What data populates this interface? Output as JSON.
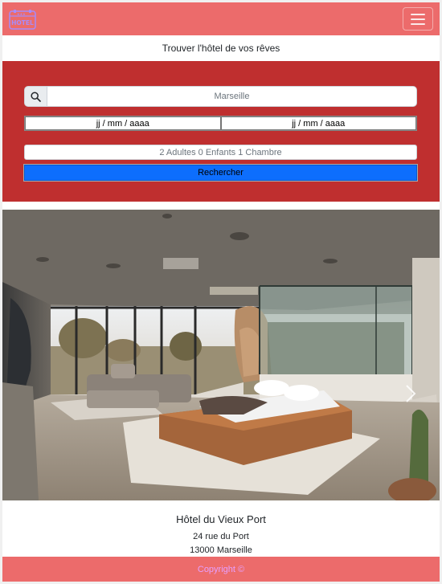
{
  "navbar": {
    "logo_text": "HOTEL",
    "menu_icon": "hamburger-icon"
  },
  "tagline": "Trouver l'hôtel de vos rêves",
  "search": {
    "destination_icon": "search-icon",
    "destination_placeholder": "Marseille",
    "checkin_placeholder": "jj / mm / aaaa",
    "checkout_placeholder": "jj / mm / aaaa",
    "guests_label": "2 Adultes 0 Enfants 1 Chambre",
    "submit_label": "Rechercher"
  },
  "carousel": {
    "next_icon": "chevron-right-icon"
  },
  "hotel": {
    "name": "Hôtel du Vieux Port",
    "street": "24 rue du Port",
    "city": "13000 Marseille"
  },
  "footer": {
    "copyright": "Copyright ©"
  },
  "colors": {
    "navbar": "#ec6b6b",
    "search_block": "#bf2f2f",
    "search_button": "#0d6efd",
    "footer_text": "#e6a0ff"
  }
}
